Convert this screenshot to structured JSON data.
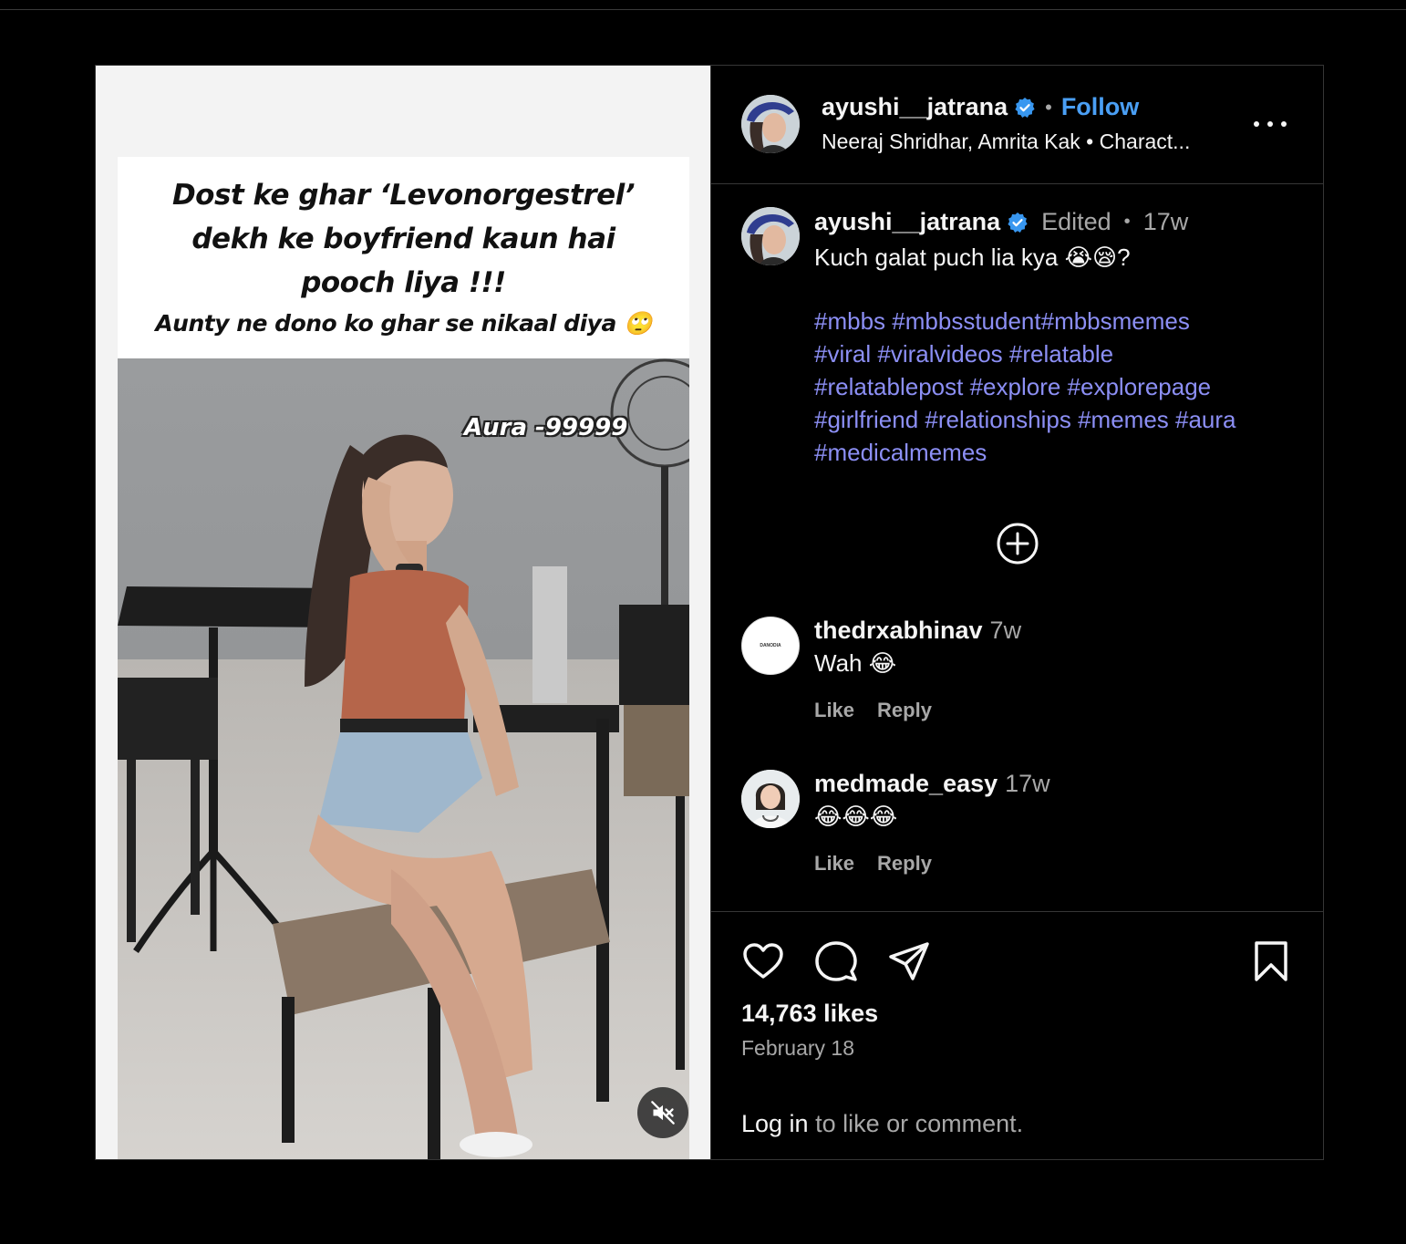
{
  "post": {
    "video_caption": {
      "line1": "Dost ke ghar ‘Levonorgestrel’",
      "line2": "dekh ke boyfriend kaun hai",
      "line3": "pooch liya !!!",
      "line4": "Aunty ne dono ko ghar se nikaal diya 🙄"
    },
    "overlay_text": "Aura -99999",
    "mute_icon": "speaker-muted-icon"
  },
  "header": {
    "username": "ayushi__jatrana",
    "separator": "•",
    "follow_label": "Follow",
    "audio": "Neeraj Shridhar, Amrita Kak • Charact...",
    "more_icon": "more-horizontal-icon"
  },
  "caption": {
    "username": "ayushi__jatrana",
    "edited": "Edited",
    "separator": "•",
    "time": "17w",
    "text": "Kuch galat puch lia kya 😭😪?",
    "hashtags": [
      "#mbbs",
      "#mbbsstudent#mbbsmemes",
      "#viral",
      "#viralvideos",
      "#relatable",
      "#relatablepost",
      "#explore",
      "#explorepage",
      "#girlfriend",
      "#relationships",
      "#memes",
      "#aura",
      "#medicalmemes"
    ]
  },
  "comments": [
    {
      "username": "thedrxabhinav",
      "time": "7w",
      "text": "Wah 😂",
      "like_label": "Like",
      "reply_label": "Reply",
      "avatar_text": "DANODIA"
    },
    {
      "username": "medmade_easy",
      "time": "17w",
      "text": "😂😂😂",
      "like_label": "Like",
      "reply_label": "Reply"
    }
  ],
  "actions": {
    "icons": [
      "heart-icon",
      "comment-icon",
      "share-icon",
      "bookmark-icon"
    ],
    "likes": "14,763 likes",
    "date": "February 18",
    "login_link": "Log in",
    "login_suffix": " to like or comment."
  },
  "colors": {
    "background": "#000000",
    "follow": "#4a9ff5",
    "hashtag": "#8c8ff5",
    "verified": "#3897f0",
    "muted_text": "#a8a8a8"
  }
}
